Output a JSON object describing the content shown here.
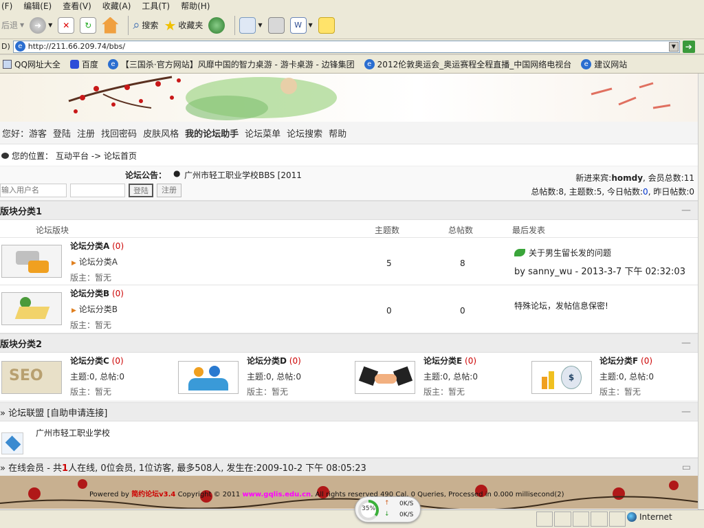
{
  "browser": {
    "menu": [
      "(F)",
      "编辑(E)",
      "查看(V)",
      "收藏(A)",
      "工具(T)",
      "帮助(H)"
    ],
    "toolbar": {
      "back": "后退",
      "search": "搜索",
      "favorites": "收藏夹"
    },
    "address": "http://211.66.209.74/bbs/",
    "address_label": "D)",
    "links": [
      "QQ网址大全",
      "百度",
      "【三国杀·官方网站】风靡中国的智力桌游 - 游卡桌游 - 边锋集团",
      "2012伦敦奥运会_奥运赛程全程直播_中国网络电视台",
      "建议网站"
    ]
  },
  "forum": {
    "nav": [
      "您好：游客",
      "登陆",
      "注册",
      "找回密码",
      "皮肤风格",
      "我的论坛助手",
      "论坛菜单",
      "论坛搜索",
      "帮助"
    ],
    "location_label": "您的位置：",
    "location_path": "互动平台 -> 论坛首页",
    "notice_label": "论坛公告：",
    "notice_text": "广州市轻工职业学校BBS [2011",
    "username_placeholder": "输入用户名",
    "login_button": "登陆",
    "register_button": "注册",
    "newest_member_label": "新进来宾:",
    "newest_member": "homdy",
    "member_total": "会员总数:11",
    "stats_a": "总帖数:8, 主题数:5, 今日帖数:",
    "today_posts": "0",
    "stats_b": ", 昨日帖数:0",
    "section1": "版块分类1",
    "col_forum": "论坛版块",
    "col_topics": "主题数",
    "col_posts": "总帖数",
    "col_last": "最后发表",
    "forums": [
      {
        "name": "论坛分类A",
        "count": "(0)",
        "child": "论坛分类A",
        "moderator": "版主：暂无",
        "topics": "5",
        "posts": "8",
        "last_title": "关于男生留长发的问题",
        "last_by": "by sanny_wu - 2013-3-7 下午 02:32:03"
      },
      {
        "name": "论坛分类B",
        "count": "(0)",
        "child": "论坛分类B",
        "moderator": "版主：暂无",
        "topics": "0",
        "posts": "0",
        "last_title": "特殊论坛，发帖信息保密!",
        "last_by": ""
      }
    ],
    "section2": "版块分类2",
    "grid": [
      {
        "name": "论坛分类C",
        "count": "(0)",
        "stats": "主题:0, 总帖:0",
        "moderator": "版主：暂无"
      },
      {
        "name": "论坛分类D",
        "count": "(0)",
        "stats": "主题:0, 总帖:0",
        "moderator": "版主：暂无"
      },
      {
        "name": "论坛分类E",
        "count": "(0)",
        "stats": "主题:0, 总帖:0",
        "moderator": "版主：暂无"
      },
      {
        "name": "论坛分类F",
        "count": "(0)",
        "stats": "主题:0, 总帖:0",
        "moderator": "版主：暂无"
      }
    ],
    "alliance_title": "» 论坛联盟 [自助申请连接]",
    "alliance_link": "广州市轻工职业学校",
    "online_prefix": "» 在线会员 - 共",
    "online_count": "1",
    "online_suffix": "人在线, 0位会员, 1位访客, 最多508人, 发生在:2009-10-2 下午 08:05:23",
    "footer_powered": "Powered by",
    "footer_brand": "简约论坛v3.4",
    "footer_copy": "Copyright © 2011",
    "footer_site": "www.gqlis.edu.cn",
    "footer_rest": ". All rights reserved 490 Cal, 0 Queries, Processed in 0.000 millisecond(2)"
  },
  "status": {
    "zone": "Internet",
    "net_percent": "35%",
    "up_speed": "0K/S",
    "down_speed": "0K/S",
    "net_level": 0.35
  },
  "colors": {
    "accent": "#cc0000",
    "link_blue": "#0033cc",
    "footer_magenta": "#ff00ff"
  }
}
